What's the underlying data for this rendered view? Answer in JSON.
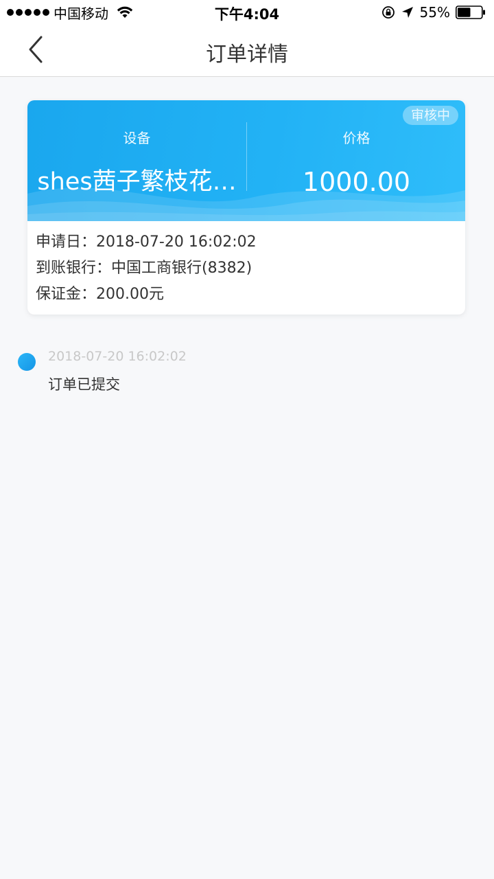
{
  "status_bar": {
    "carrier": "中国移动",
    "time": "下午4:04",
    "battery": "55%",
    "battery_level": 0.55
  },
  "nav": {
    "title": "订单详情"
  },
  "card": {
    "status_badge": "审核中",
    "device_label": "设备",
    "device_value": "shes茜子繁枝花…",
    "price_label": "价格",
    "price_value": "1000.00",
    "apply_date": "申请日：2018-07-20 16:02:02",
    "bank": "到账银行：中国工商银行(8382)",
    "deposit": "保证金：200.00元"
  },
  "timeline": [
    {
      "time": "2018-07-20 16:02:02",
      "text": "订单已提交"
    }
  ],
  "colors": {
    "accent": "#1aa7ee",
    "background": "#f7f8fa"
  }
}
